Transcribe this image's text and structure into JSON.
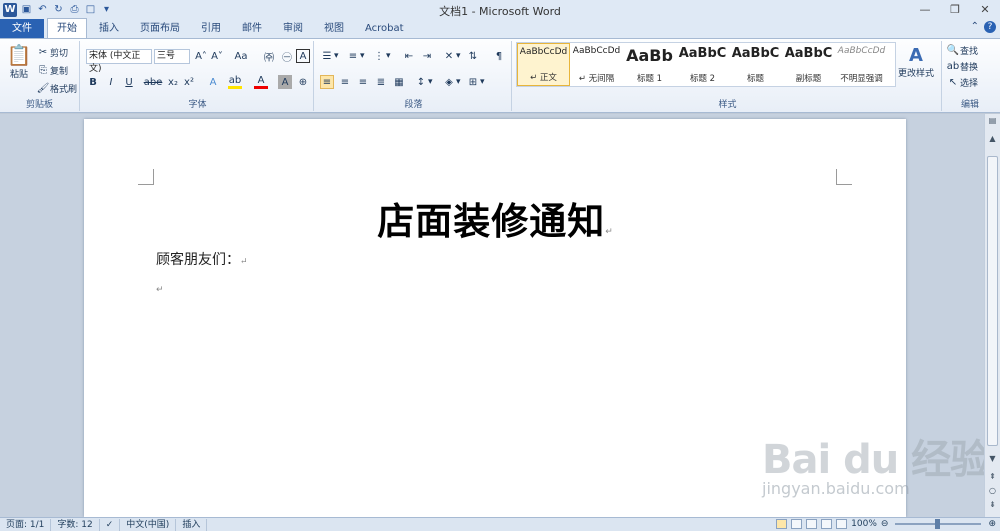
{
  "window": {
    "title": "文档1 - Microsoft Word"
  },
  "quick_access": {
    "icons": [
      "word-logo-icon",
      "save-icon",
      "undo-icon",
      "redo-icon",
      "print-preview-icon",
      "new-doc-icon",
      "customize-icon"
    ]
  },
  "tabs": [
    "文件",
    "开始",
    "插入",
    "页面布局",
    "引用",
    "邮件",
    "审阅",
    "视图",
    "Acrobat"
  ],
  "active_tab": "开始",
  "ribbon": {
    "clipboard": {
      "paste": "粘贴",
      "cut": "剪切",
      "copy": "复制",
      "format_painter": "格式刷",
      "label": "剪贴板"
    },
    "font": {
      "font_name": "宋体 (中文正文)",
      "font_size": "三号",
      "bold": "B",
      "italic": "I",
      "underline": "U",
      "strike": "abe",
      "subscript": "x₂",
      "superscript": "x²",
      "grow": "A˄",
      "shrink": "A˅",
      "case": "Aa",
      "label": "字体"
    },
    "paragraph": {
      "label": "段落"
    },
    "styles": {
      "items": [
        {
          "preview": "AaBbCcDd",
          "name": "↵ 正文"
        },
        {
          "preview": "AaBbCcDd",
          "name": "↵ 无间隔"
        },
        {
          "preview": "AaBb",
          "name": "标题 1"
        },
        {
          "preview": "AaBbC",
          "name": "标题 2"
        },
        {
          "preview": "AaBbC",
          "name": "标题"
        },
        {
          "preview": "AaBbC",
          "name": "副标题"
        },
        {
          "preview": "AaBbCcDd",
          "name": "不明显强调"
        }
      ],
      "change": "更改样式",
      "label": "样式"
    },
    "editing": {
      "find": "查找",
      "replace": "替换",
      "select": "选择",
      "label": "编辑"
    }
  },
  "document": {
    "title": "店面装修通知",
    "greeting": "顾客朋友们：",
    "para_mark": "↵"
  },
  "status": {
    "page": "页面: 1/1",
    "words": "字数: 12",
    "language": "中文(中国)",
    "mode": "插入",
    "zoom": "100%"
  },
  "watermark": {
    "logo": "Bai du 经验",
    "url": "jingyan.baidu.com"
  }
}
